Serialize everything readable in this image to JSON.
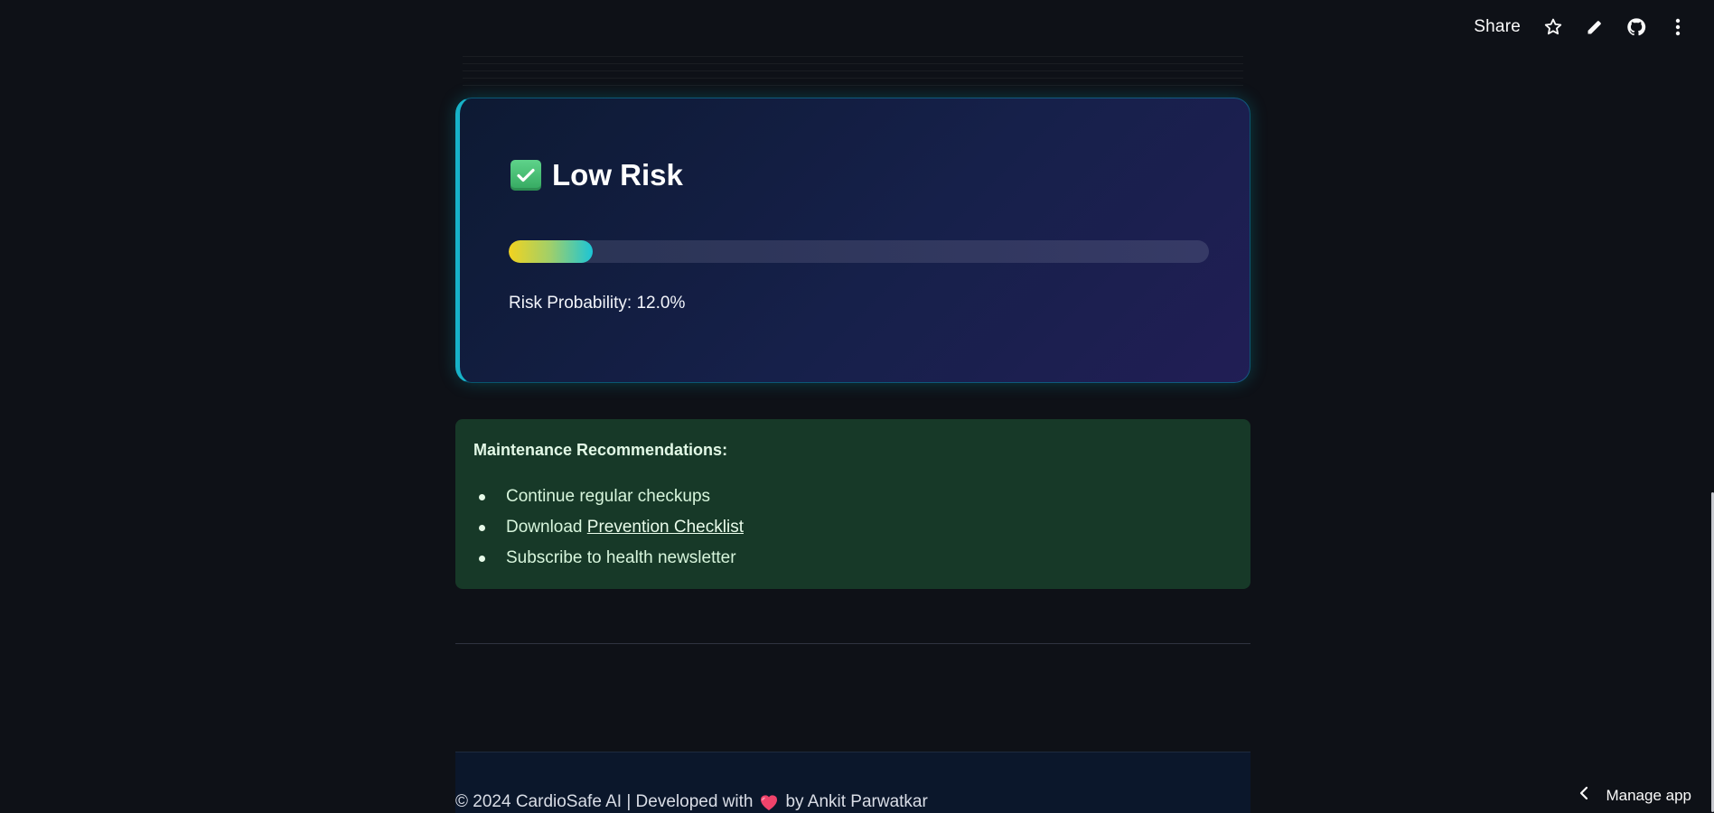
{
  "toolbar": {
    "share_label": "Share",
    "icons": [
      "star-icon",
      "pencil-icon",
      "github-icon",
      "more-vertical-icon"
    ]
  },
  "risk_card": {
    "icon": "check-mark-icon",
    "title": "Low Risk",
    "probability_text": "Risk Probability: 12.0%",
    "probability_fraction": 0.12,
    "accent_color": "#17b3c9"
  },
  "recommendations": {
    "title": "Maintenance Recommendations:",
    "item1": "Continue regular checkups",
    "item2_prefix": "Download",
    "item2_link": "Prevention Checklist",
    "item3": "Subscribe to health newsletter",
    "background_color": "#173928"
  },
  "footer": {
    "text_before": "© 2024 CardioSafe AI | Developed with",
    "icon": "heart-icon",
    "text_after": "by Ankit Parwatkar"
  },
  "manage_app": {
    "label": "Manage app",
    "icon": "chevron-left-icon"
  }
}
